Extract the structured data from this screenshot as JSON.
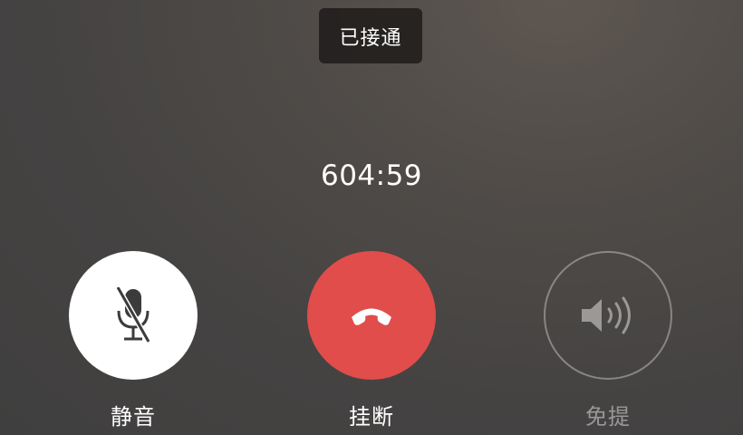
{
  "call": {
    "status": "已接通",
    "duration": "604:59"
  },
  "controls": {
    "mute": {
      "label": "静音",
      "icon": "mic-off-icon"
    },
    "hangup": {
      "label": "挂断",
      "icon": "phone-hangup-icon",
      "color": "#e04d4b"
    },
    "speaker": {
      "label": "免提",
      "icon": "speaker-icon"
    }
  }
}
